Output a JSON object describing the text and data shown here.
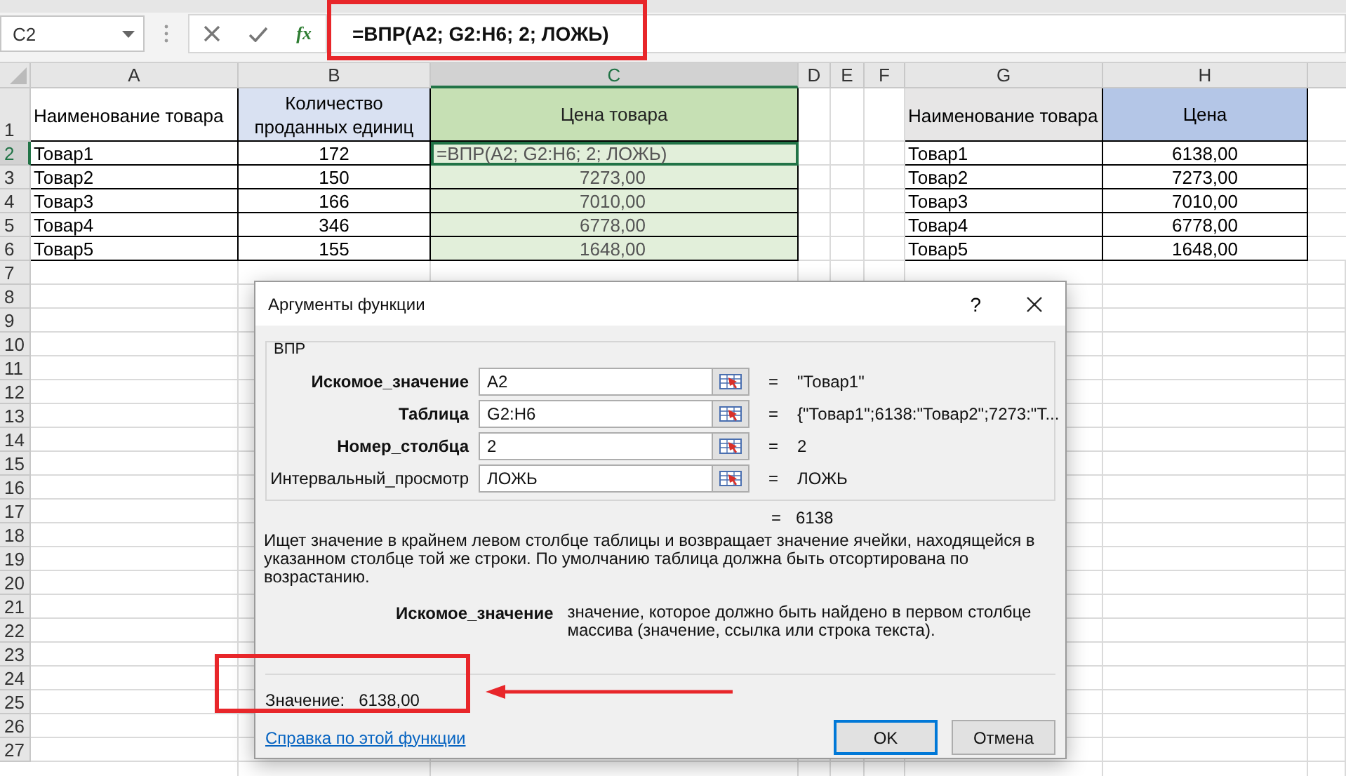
{
  "name_box": {
    "value": "C2"
  },
  "formula_bar": {
    "function_label": "fx",
    "value": "=ВПР(A2; G2:H6; 2; ЛОЖЬ)"
  },
  "sheet": {
    "columns": [
      {
        "label": "A",
        "selected": false
      },
      {
        "label": "B",
        "selected": false
      },
      {
        "label": "C",
        "selected": true
      },
      {
        "label": "D",
        "selected": false
      },
      {
        "label": "E",
        "selected": false
      },
      {
        "label": "F",
        "selected": false
      },
      {
        "label": "G",
        "selected": false
      },
      {
        "label": "H",
        "selected": false
      }
    ],
    "rows": [
      {
        "label": "1",
        "selected": false,
        "cells": [
          "Наименование товара",
          "Количество проданных единиц",
          "Цена товара",
          "",
          "",
          "",
          "Наименование товара",
          "Цена"
        ]
      },
      {
        "label": "2",
        "selected": true,
        "cells": [
          "Товар1",
          "172",
          "=ВПР(A2; G2:H6; 2; ЛОЖЬ)",
          "",
          "",
          "",
          "Товар1",
          "6138,00"
        ]
      },
      {
        "label": "3",
        "selected": false,
        "cells": [
          "Товар2",
          "150",
          "7273,00",
          "",
          "",
          "",
          "Товар2",
          "7273,00"
        ]
      },
      {
        "label": "4",
        "selected": false,
        "cells": [
          "Товар3",
          "166",
          "7010,00",
          "",
          "",
          "",
          "Товар3",
          "7010,00"
        ]
      },
      {
        "label": "5",
        "selected": false,
        "cells": [
          "Товар4",
          "346",
          "6778,00",
          "",
          "",
          "",
          "Товар4",
          "6778,00"
        ]
      },
      {
        "label": "6",
        "selected": false,
        "cells": [
          "Товар5",
          "155",
          "1648,00",
          "",
          "",
          "",
          "Товар5",
          "1648,00"
        ]
      },
      {
        "label": "7",
        "selected": false
      },
      {
        "label": "8",
        "selected": false
      },
      {
        "label": "9",
        "selected": false
      },
      {
        "label": "10",
        "selected": false
      },
      {
        "label": "11",
        "selected": false
      },
      {
        "label": "12",
        "selected": false
      },
      {
        "label": "13",
        "selected": false
      },
      {
        "label": "14",
        "selected": false
      },
      {
        "label": "15",
        "selected": false
      },
      {
        "label": "16",
        "selected": false
      },
      {
        "label": "17",
        "selected": false
      },
      {
        "label": "18",
        "selected": false
      },
      {
        "label": "19",
        "selected": false
      },
      {
        "label": "20",
        "selected": false
      },
      {
        "label": "21",
        "selected": false
      },
      {
        "label": "22",
        "selected": false
      },
      {
        "label": "23",
        "selected": false
      },
      {
        "label": "24",
        "selected": false
      },
      {
        "label": "25",
        "selected": false
      },
      {
        "label": "26",
        "selected": false
      },
      {
        "label": "27",
        "selected": false
      }
    ]
  },
  "dialog": {
    "title": "Аргументы функции",
    "help_button": "?",
    "function_name": "ВПР",
    "arguments": [
      {
        "label": "Искомое_значение",
        "required": true,
        "value": "A2",
        "sign": "=",
        "result": "\"Товар1\""
      },
      {
        "label": "Таблица",
        "required": true,
        "value": "G2:H6",
        "sign": "=",
        "result": "{\"Товар1\";6138:\"Товар2\";7273:\"Т..."
      },
      {
        "label": "Номер_столбца",
        "required": true,
        "value": "2",
        "sign": "=",
        "result": "2"
      },
      {
        "label": "Интервальный_просмотр",
        "required": false,
        "value": "ЛОЖЬ",
        "sign": "=",
        "result": "ЛОЖЬ"
      }
    ],
    "formula_result": {
      "sign": "=",
      "value": "6138"
    },
    "description": "Ищет значение в крайнем левом столбце таблицы и возвращает значение ячейки, находящейся в указанном столбце той же строки. По умолчанию таблица должна быть отсортирована по возрастанию.",
    "argument_help": {
      "label": "Искомое_значение",
      "text": "значение, которое должно быть найдено в первом столбце массива (значение, ссылка или строка текста)."
    },
    "value_label": "Значение:",
    "value": "6138,00",
    "help_link": "Справка по этой функции",
    "buttons": [
      {
        "label": "OK",
        "default": true
      },
      {
        "label": "Отмена",
        "default": false
      }
    ]
  }
}
